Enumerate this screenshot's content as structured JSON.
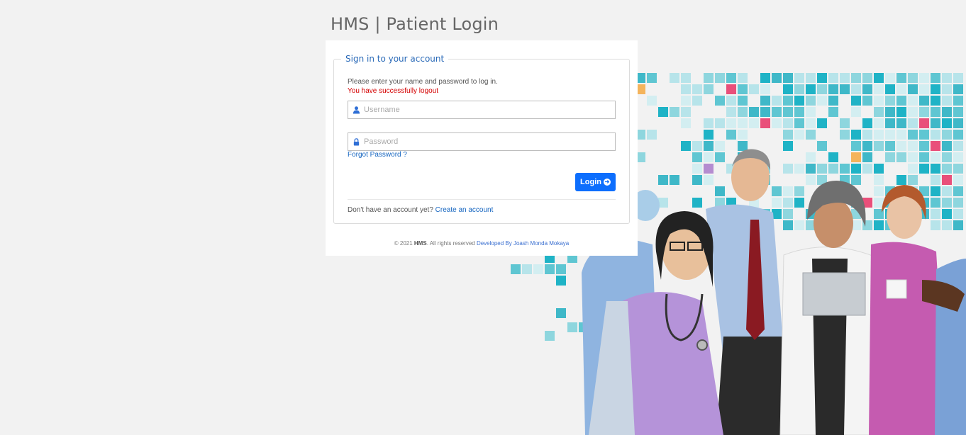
{
  "page": {
    "title": "HMS | Patient Login"
  },
  "form": {
    "legend": "Sign in to your account",
    "intro": "Please enter your name and password to log in.",
    "message": "You have successfully logout",
    "username_placeholder": "Username",
    "password_placeholder": "Password",
    "forgot_label": "Forgot Password ?",
    "login_label": "Login",
    "signup_text": "Don't have an account yet?",
    "signup_link": "Create an account"
  },
  "footer": {
    "copyright": "© 2021",
    "brand": "HMS",
    "rights": ". All rights reserved",
    "developer": "Developed By Joash Monda Mokaya"
  },
  "colors": {
    "accent": "#0d6efd",
    "error": "#d40000",
    "link": "#1565c0"
  },
  "icons": {
    "username": "user-icon",
    "password": "lock-icon",
    "login": "arrow-circle-right-icon"
  }
}
